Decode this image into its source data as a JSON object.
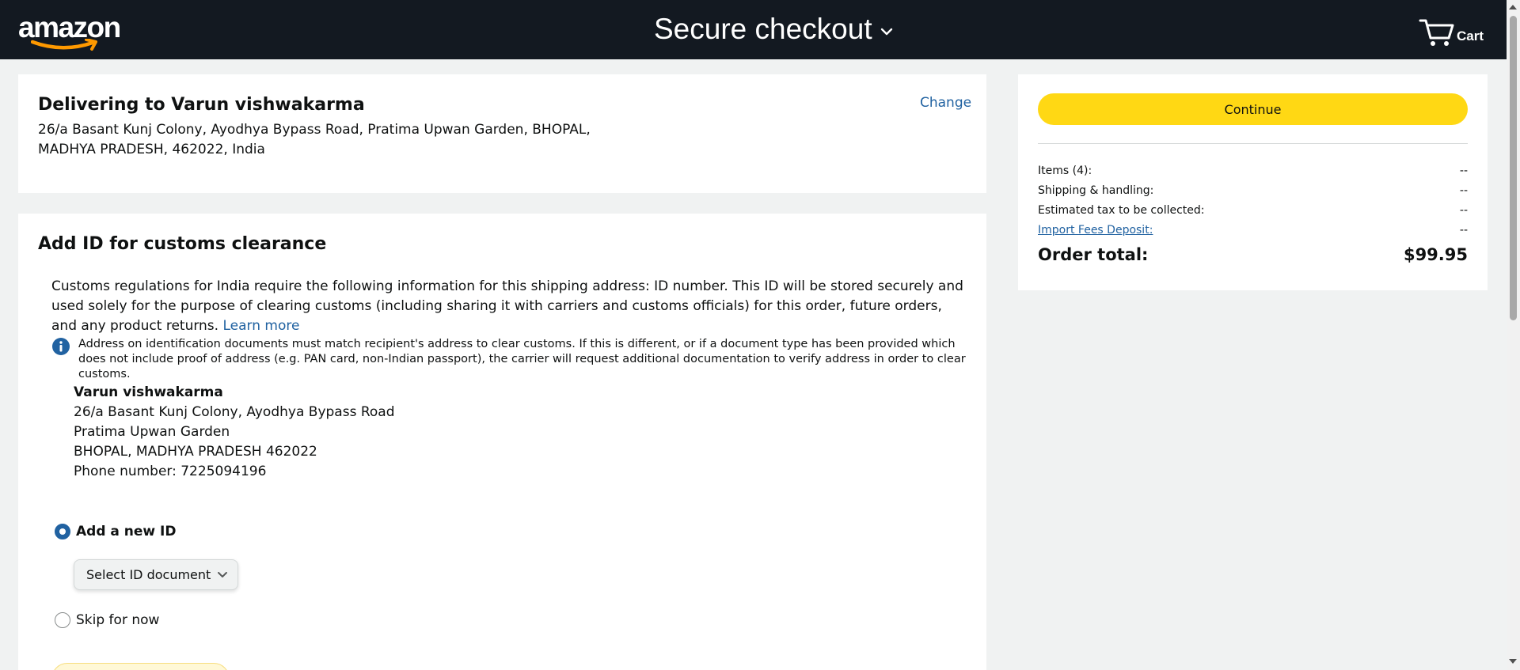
{
  "header": {
    "logo_text": "amazon",
    "title": "Secure checkout",
    "cart_label": "Cart"
  },
  "delivery": {
    "title": "Delivering to Varun vishwakarma",
    "address": "26/a Basant Kunj Colony, Ayodhya Bypass Road, Pratima Upwan Garden, BHOPAL, MADHYA PRADESH, 462022, India",
    "change_label": "Change"
  },
  "customs": {
    "title": "Add ID for customs clearance",
    "description": "Customs regulations for India require the following information for this shipping address: ID number. This ID will be stored securely and used solely for the purpose of clearing customs (including sharing it with carriers and customs officials) for this order, future orders, and any product returns.",
    "learn_more": "Learn more",
    "info_text": "Address on identification documents must match recipient's address to clear customs. If this is different, or if a document type has been provided which does not include proof of address (e.g. PAN card, non-Indian passport), the carrier will request additional documentation to verify address in order to clear customs.",
    "recipient": {
      "name": "Varun vishwakarma",
      "line1": "26/a Basant Kunj Colony, Ayodhya Bypass Road",
      "line2": "Pratima Upwan Garden",
      "line3": "BHOPAL, MADHYA PRADESH 462022",
      "phone": "Phone number: 7225094196"
    },
    "options": {
      "add_new": "Add a new ID",
      "select_label": "Select ID document",
      "skip": "Skip for now"
    }
  },
  "summary": {
    "continue_label": "Continue",
    "rows": [
      {
        "label": "Items (4):",
        "value": "--"
      },
      {
        "label": "Shipping & handling:",
        "value": "--"
      },
      {
        "label": "Estimated tax to be collected:",
        "value": "--"
      },
      {
        "label": "Import Fees Deposit:",
        "value": "--"
      }
    ],
    "total_label": "Order total:",
    "total_value": "$99.95"
  },
  "colors": {
    "header_bg": "#131921",
    "link": "#2162a1",
    "button_yellow": "#ffd814",
    "page_bg": "#f0f2f2"
  }
}
